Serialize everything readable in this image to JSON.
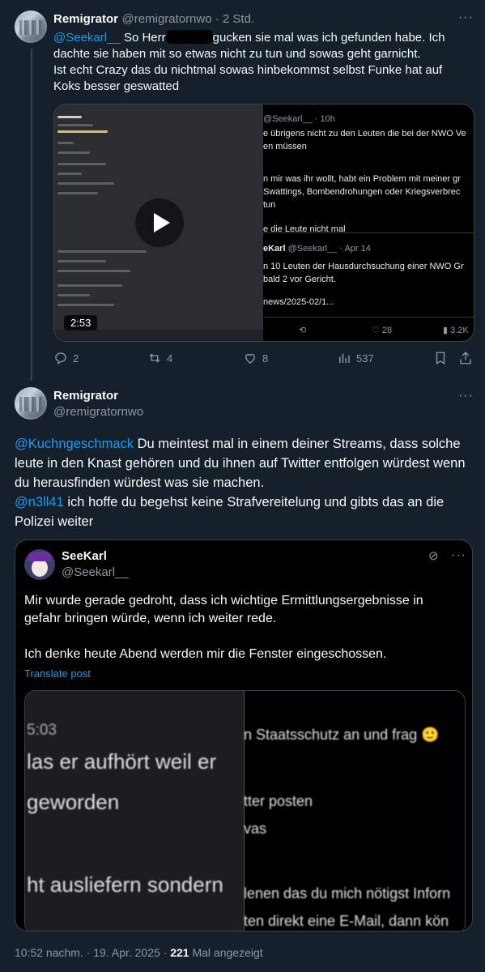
{
  "reply": {
    "display_name": "Remigrator",
    "handle": "@remigratornwo",
    "time": "2 Std.",
    "mention": "@Seekarl__",
    "text_part1": "So Herr",
    "text_part2": "gucken sie mal was ich gefunden habe. Ich dachte sie haben mit so etwas nicht zu tun und sowas geht garnicht.",
    "text_part3": "Ist echt Crazy das du nichtmal sowas hinbekommst selbst Funke hat auf Koks besser geswatted",
    "video_duration": "2:53",
    "video_right": {
      "top_meta": "@Seekarl__ · 10h",
      "line1": "e übrigens nicht zu den Leuten die bei der NWO Ve",
      "line2": "en müssen",
      "line3": "n mir was ihr wollt, habt ein Problem mit meiner gr",
      "line4": "Swattings, Bombendrohungen oder Kriegsverbrec",
      "line5": "tun",
      "line6": "e die Leute nicht mal",
      "name2": "eKarl",
      "meta2": "@Seekarl__ · Apr 14",
      "line7": "n 10 Leuten der Hausdurchsuchung einer NWO Gr",
      "line8": "bald 2 vor Gericht.",
      "line9": "news/2025-02/1...",
      "count_likes": "28",
      "count_views": "3.2K"
    },
    "stats": {
      "replies": "2",
      "reposts": "4",
      "likes": "8",
      "views": "537"
    }
  },
  "main": {
    "display_name": "Remigrator",
    "handle": "@remigratornwo",
    "mention1": "@Kuchngeschmack",
    "text1": "Du meintest mal in einem deiner Streams, dass solche leute in den Knast gehören und du  ihnen auf Twitter entfolgen würdest wenn du herausfinden würdest was sie machen.",
    "mention2": "@n3ll41",
    "text2": "ich hoffe du begehst keine Strafvereitelung und gibts das an die Polizei weiter"
  },
  "quote": {
    "display_name": "SeeKarl",
    "handle": "@Seekarl__",
    "text1": "Mir wurde gerade gedroht, dass ich wichtige Ermittlungsergebnisse in gefahr bringen würde, wenn ich weiter rede.",
    "text2": "Ich denke heute Abend werden mir die Fenster eingeschossen.",
    "translate": "Translate post",
    "image": {
      "left_time": "5:03",
      "left_line1": "las er aufhört weil er",
      "left_line2": "geworden",
      "left_line3": "ht ausliefern sondern",
      "right_line1": "n Staatsschutz an und frag",
      "right_line2": "tter posten",
      "right_line3": "vas",
      "right_line4": "lenen das du mich nötigst Inforn",
      "right_line5": "ten direkt eine E-Mail, dann kön"
    }
  },
  "footer": {
    "time": "10:52 nachm. · 19. Apr. 2025 ·",
    "views": "221",
    "views_label": "Mal angezeigt"
  }
}
